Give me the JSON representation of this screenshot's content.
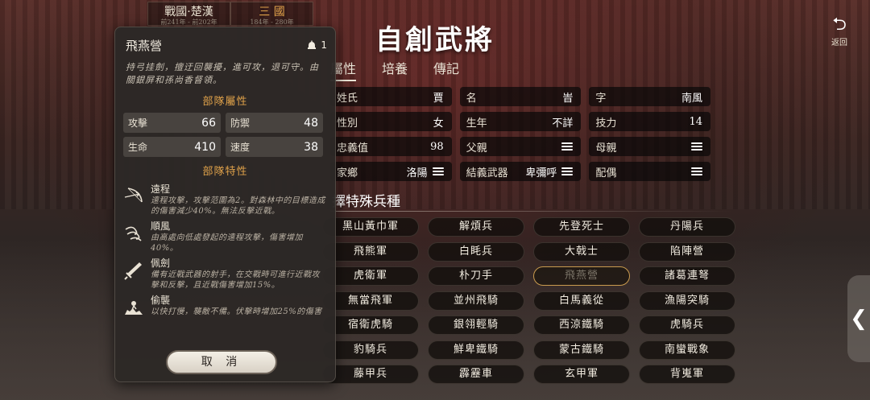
{
  "era_tabs": [
    {
      "name": "戰國·楚漢",
      "years": "前241年 - 前202年"
    },
    {
      "name": "三 國",
      "years": "184年 - 280年"
    }
  ],
  "title": "自創武將",
  "back": {
    "icon": "back-arrow-icon",
    "label": "返回"
  },
  "main_tabs": [
    "屬性",
    "培養",
    "傳記"
  ],
  "attributes": {
    "surname": {
      "key": "姓氏",
      "value": "賈"
    },
    "given_name": {
      "key": "名",
      "value": "峕"
    },
    "courtesy": {
      "key": "字",
      "value": "南風"
    },
    "gender": {
      "key": "性別",
      "value": "女"
    },
    "birth_year": {
      "key": "生年",
      "value": "不詳"
    },
    "skill": {
      "key": "技力",
      "value": "14"
    },
    "loyalty": {
      "key": "忠義值",
      "value": "98"
    },
    "father": {
      "key": "父親",
      "value": ""
    },
    "mother": {
      "key": "母親",
      "value": ""
    },
    "hometown": {
      "key": "家鄉",
      "value": "洛陽"
    },
    "sworn": {
      "key": "結義武器",
      "value": "卑彌呼"
    },
    "spouse": {
      "key": "配偶",
      "value": ""
    }
  },
  "special_title": "擇特殊兵種",
  "troops": [
    "黑山黃巾軍",
    "解煩兵",
    "先登死士",
    "丹陽兵",
    "飛熊軍",
    "白眊兵",
    "大戟士",
    "陷陣營",
    "虎衛軍",
    "朴刀手",
    "飛燕營",
    "諸葛連弩",
    "無當飛軍",
    "並州飛騎",
    "白馬義從",
    "漁陽突騎",
    "宿衛虎騎",
    "銀翎輕騎",
    "西涼鐵騎",
    "虎騎兵",
    "豹騎兵",
    "鮮卑鐵騎",
    "蒙古鐵騎",
    "南蠻戰象",
    "藤甲兵",
    "霹靂車",
    "玄甲軍",
    "背嵬軍"
  ],
  "selected_troop_index": 10,
  "popup": {
    "title": "飛燕營",
    "count": "1",
    "description": "持弓挂劍，擅迂回襲擾，進可攻，退可守。由關銀屏和孫尚香督領。",
    "attr_heading": "部隊屬性",
    "stats": [
      {
        "key": "攻擊",
        "value": "66"
      },
      {
        "key": "防禦",
        "value": "48"
      },
      {
        "key": "生命",
        "value": "410"
      },
      {
        "key": "速度",
        "value": "38"
      }
    ],
    "trait_heading": "部隊特性",
    "traits": [
      {
        "icon": "bow-icon",
        "name": "遠程",
        "desc": "遠程攻擊，攻擊范圍為2。對森林中的目標造成的傷害減少40%。無法反擊近戰。"
      },
      {
        "icon": "wind-icon",
        "name": "順風",
        "desc": "由高處向低處發起的遠程攻擊，傷害增加40%。"
      },
      {
        "icon": "sword-icon",
        "name": "佩劍",
        "desc": "備有近戰武器的射手，在交戰時可進行近戰攻擊和反擊，且近戰傷害增加15%。"
      },
      {
        "icon": "ambush-icon",
        "name": "偷襲",
        "desc": "以快打慢，襲敵不備。伏擊時增加25%的傷害"
      }
    ],
    "cancel_label": "取 消"
  },
  "colors": {
    "accent": "#e0a24a",
    "panel": "#2c2826",
    "selected_border": "#c99b4e"
  }
}
